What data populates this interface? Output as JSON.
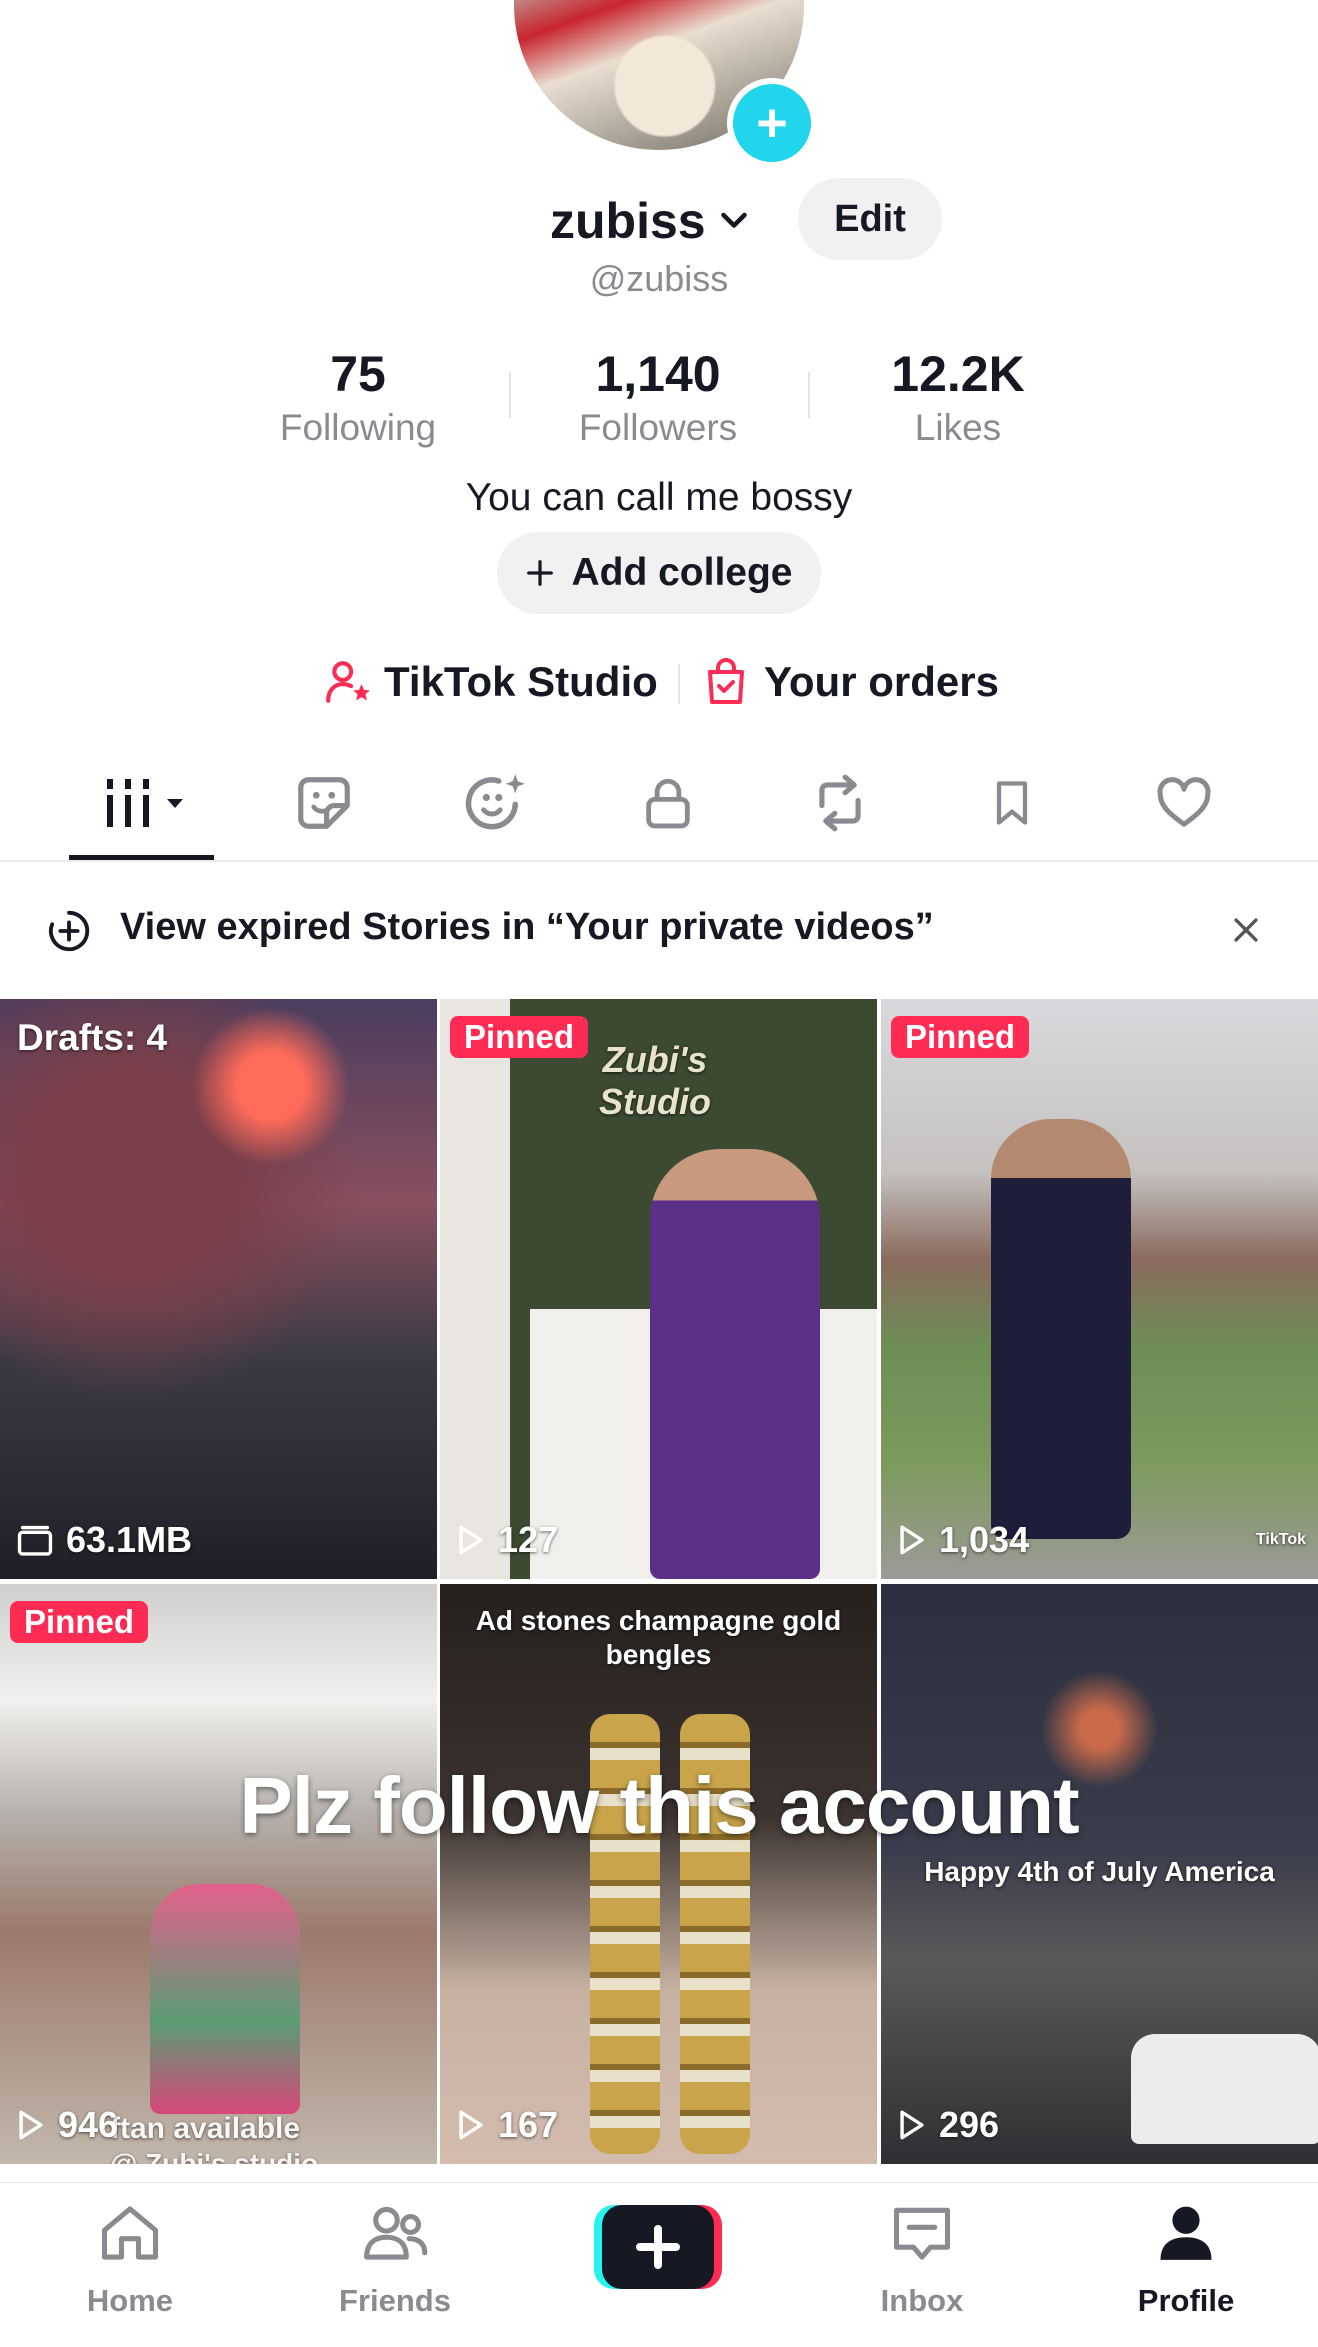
{
  "profile": {
    "username": "zubiss",
    "handle": "@zubiss",
    "edit_label": "Edit",
    "bio": "You can call me bossy",
    "add_college_label": "Add college",
    "stats": [
      {
        "value": "75",
        "label": "Following"
      },
      {
        "value": "1,140",
        "label": "Followers"
      },
      {
        "value": "12.2K",
        "label": "Likes"
      }
    ],
    "links": {
      "studio": "TikTok Studio",
      "orders": "Your orders"
    }
  },
  "tabs": [
    "videos",
    "stickers",
    "ai-self",
    "private",
    "reposts",
    "favorites",
    "liked"
  ],
  "banner": {
    "text": "View expired Stories in “Your private videos”"
  },
  "grid": {
    "tiles": [
      {
        "drafts": "Drafts: 4",
        "size": "63.1MB"
      },
      {
        "badge": "Pinned",
        "views": "127",
        "sign_text": "Zubi's Studio"
      },
      {
        "badge": "Pinned",
        "views": "1,034",
        "watermark": "TikTok"
      },
      {
        "badge": "Pinned",
        "views": "946",
        "caption": "ftan available",
        "caption2": "@ Zubi's studio"
      },
      {
        "views": "167",
        "caption": "Ad stones champagne gold bengles"
      },
      {
        "views": "296",
        "caption": "Happy 4th of July America"
      }
    ],
    "overlay": "Plz follow this account"
  },
  "nav": {
    "home": "Home",
    "friends": "Friends",
    "inbox": "Inbox",
    "profile": "Profile"
  },
  "colors": {
    "accent": "#fe2c55",
    "teal": "#20d5ec",
    "text": "#161823",
    "muted": "#8a8b91"
  }
}
